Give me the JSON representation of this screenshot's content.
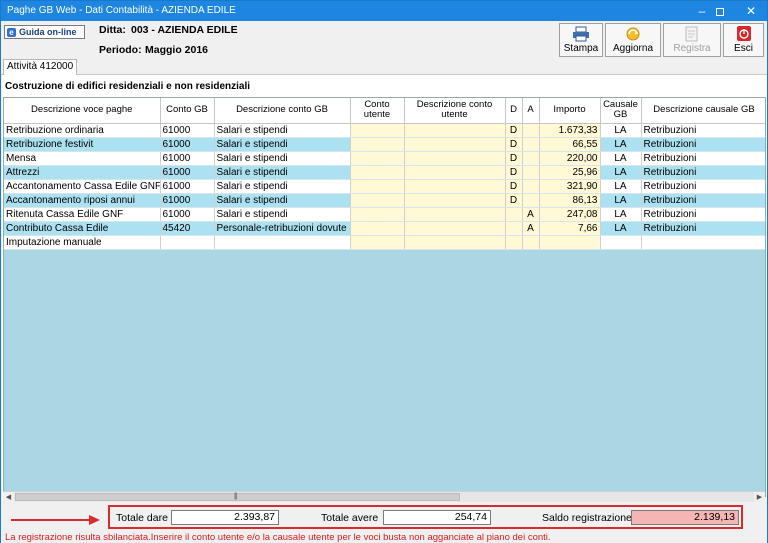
{
  "window": {
    "title": "Paghe GB Web - Dati Contabilità - AZIENDA EDILE",
    "controls": {
      "minimize": "–",
      "close": "✕"
    }
  },
  "header": {
    "guida_label": "Guida on-line",
    "ditta_label": "Ditta:",
    "ditta_value": "003 - AZIENDA EDILE",
    "periodo_label": "Periodo:",
    "periodo_value": "Maggio 2016"
  },
  "toolbar": {
    "stampa": {
      "label": "Stampa",
      "icon": "printer-icon"
    },
    "aggiorna": {
      "label": "Aggiorna",
      "icon": "refresh-icon"
    },
    "registra": {
      "label": "Registra",
      "icon": "register-icon",
      "disabled": true
    },
    "esci": {
      "label": "Esci",
      "icon": "power-icon"
    }
  },
  "tab": {
    "label": "Attività 412000"
  },
  "section_title": "Costruzione di edifici residenziali e non residenziali",
  "table": {
    "columns": [
      "Descrizione voce paghe",
      "Conto GB",
      "Descrizione conto GB",
      "Conto utente",
      "Descrizione conto utente",
      "D",
      "A",
      "Importo",
      "Causale GB",
      "Descrizione causale GB"
    ],
    "rows": [
      [
        "Retribuzione ordinaria",
        "61000",
        "Salari e stipendi",
        "",
        "",
        "D",
        "",
        "1.673,33",
        "LA",
        "Retribuzioni"
      ],
      [
        "Retribuzione festivit",
        "61000",
        "Salari e stipendi",
        "",
        "",
        "D",
        "",
        "66,55",
        "LA",
        "Retribuzioni"
      ],
      [
        "Mensa",
        "61000",
        "Salari e stipendi",
        "",
        "",
        "D",
        "",
        "220,00",
        "LA",
        "Retribuzioni"
      ],
      [
        "Attrezzi",
        "61000",
        "Salari e stipendi",
        "",
        "",
        "D",
        "",
        "25,96",
        "LA",
        "Retribuzioni"
      ],
      [
        "Accantonamento Cassa Edile GNF",
        "61000",
        "Salari e stipendi",
        "",
        "",
        "D",
        "",
        "321,90",
        "LA",
        "Retribuzioni"
      ],
      [
        "Accantonamento riposi annui",
        "61000",
        "Salari e stipendi",
        "",
        "",
        "D",
        "",
        "86,13",
        "LA",
        "Retribuzioni"
      ],
      [
        "Ritenuta Cassa Edile GNF",
        "61000",
        "Salari e stipendi",
        "",
        "",
        "",
        "A",
        "247,08",
        "LA",
        "Retribuzioni"
      ],
      [
        "Contributo Cassa Edile",
        "45420",
        "Personale-retribuzioni dovute",
        "",
        "",
        "",
        "A",
        "7,66",
        "LA",
        "Retribuzioni"
      ],
      [
        "Imputazione manuale",
        "",
        "",
        "",
        "",
        "",
        "",
        "",
        "",
        ""
      ]
    ]
  },
  "totals": {
    "dare_label": "Totale dare",
    "dare_value": "2.393,87",
    "avere_label": "Totale avere",
    "avere_value": "254,74",
    "saldo_label": "Saldo registrazione",
    "saldo_value": "2.139,13"
  },
  "warning": "La registrazione risulta sbilanciata.Inserire il conto utente e/o la causale utente per le voci busta non agganciate al piano dei conti.",
  "colors": {
    "titlebar": "#1e86e0",
    "row_alt": "#ace1f1",
    "grid_bg": "#abd7e4",
    "yellow_cell": "#fff9d6",
    "saldo_bg": "#f5b5b5",
    "warning": "#d11f1f"
  }
}
